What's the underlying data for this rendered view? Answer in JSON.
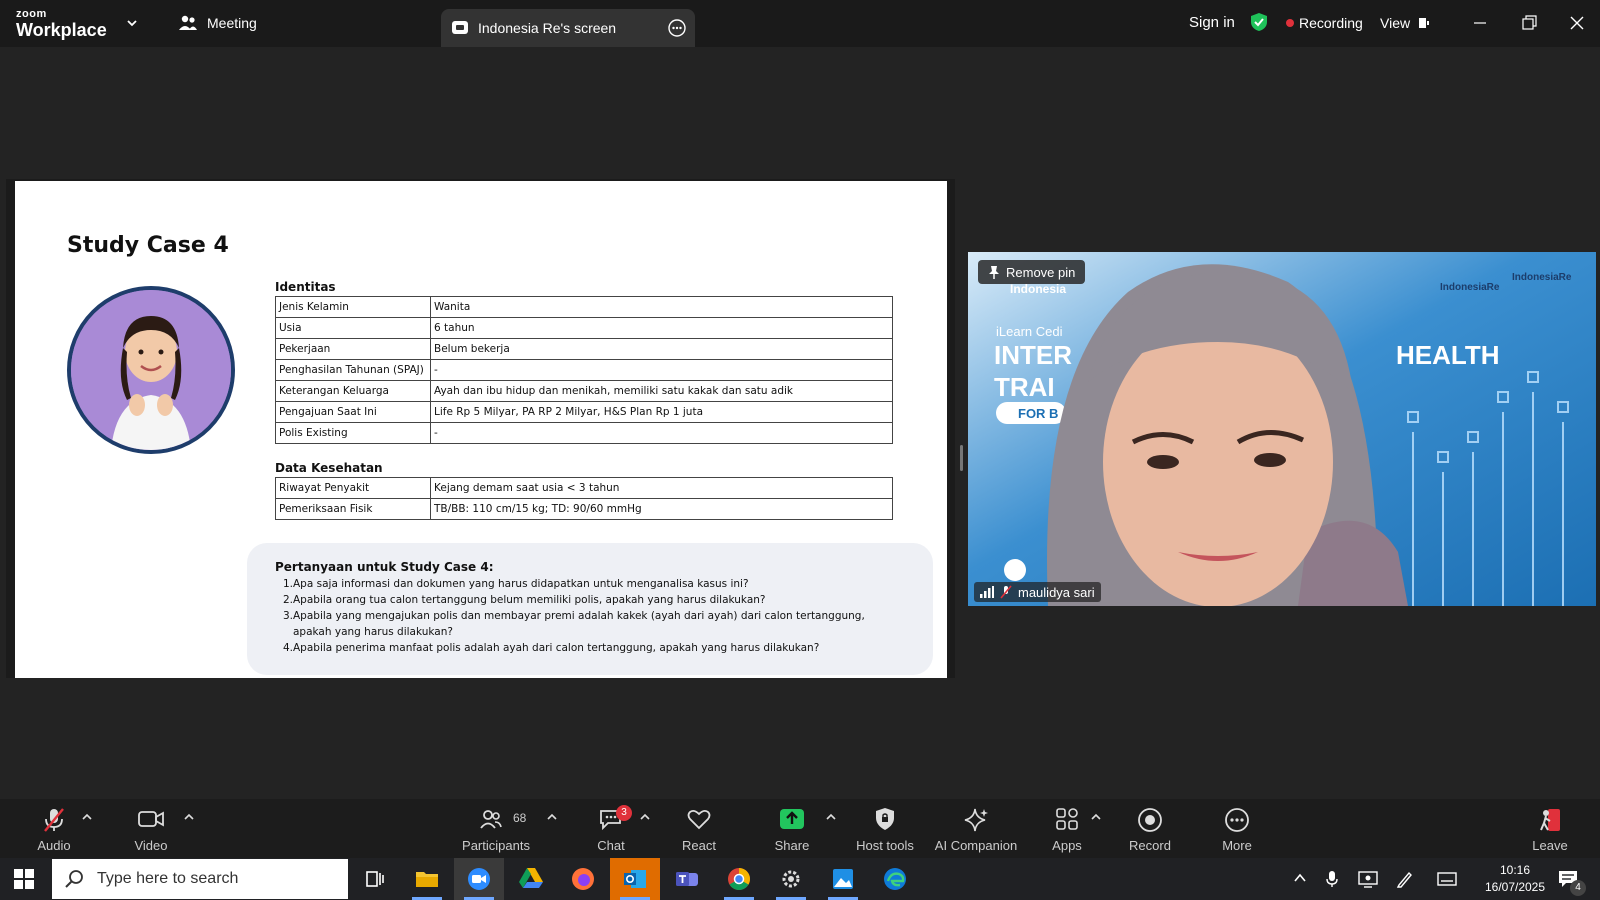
{
  "app": {
    "brand_small": "zoom",
    "brand_big": "Workplace",
    "meeting_tab": "Meeting",
    "screen_tab": "Indonesia Re's screen",
    "sign_in": "Sign in",
    "recording": "Recording",
    "view": "View"
  },
  "slide": {
    "title": "Study Case 4",
    "identitas_title": "Identitas",
    "identitas_rows": [
      {
        "k": "Jenis Kelamin",
        "v": "Wanita"
      },
      {
        "k": "Usia",
        "v": "6 tahun"
      },
      {
        "k": "Pekerjaan",
        "v": "Belum bekerja"
      },
      {
        "k": "Penghasilan Tahunan (SPAJ)",
        "v": "-"
      },
      {
        "k": "Keterangan Keluarga",
        "v": "Ayah dan ibu hidup dan menikah, memiliki satu kakak dan satu adik"
      },
      {
        "k": "Pengajuan Saat Ini",
        "v": "Life Rp 5 Milyar, PA RP 2 Milyar, H&S Plan Rp 1 juta"
      },
      {
        "k": "Polis Existing",
        "v": "-"
      }
    ],
    "kesehatan_title": "Data Kesehatan",
    "kesehatan_rows": [
      {
        "k": "Riwayat Penyakit",
        "v": "Kejang demam saat usia < 3 tahun"
      },
      {
        "k": "Pemeriksaan Fisik",
        "v": "TB/BB: 110 cm/15 kg; TD: 90/60 mmHg"
      }
    ],
    "questions_title": "Pertanyaan untuk Study Case 4:",
    "questions": [
      {
        "n": "1.",
        "t": "Apa saja informasi dan dokumen yang harus didapatkan untuk menganalisa kasus ini?"
      },
      {
        "n": "2.",
        "t": "Apabila orang tua calon tertanggung belum memiliki polis, apakah yang harus dilakukan?"
      },
      {
        "n": "3.",
        "t": "Apabila yang mengajukan polis dan membayar premi adalah kakek (ayah dari ayah) dari calon tertanggung, apakah yang harus dilakukan?"
      },
      {
        "n": "4.",
        "t": "Apabila penerima manfaat polis adalah ayah dari calon tertanggung, apakah yang harus dilakukan?"
      }
    ]
  },
  "video": {
    "remove_pin": "Remove pin",
    "participant": "maulidya sari",
    "bg_brand_left": "Indonesia",
    "bg_text_ilearn": "iLearn Cedi",
    "bg_text_inter": "INTER",
    "bg_text_train": "TRAI",
    "bg_text_health": "HEALTH",
    "bg_text_for": "FOR B",
    "bg_logo_1": "IndonesiaRe",
    "bg_logo_2": "IndonesiaRe"
  },
  "toolbar": {
    "audio": "Audio",
    "video": "Video",
    "participants": "Participants",
    "participants_count": "68",
    "chat": "Chat",
    "chat_badge": "3",
    "react": "React",
    "share": "Share",
    "host_tools": "Host tools",
    "ai_companion": "AI Companion",
    "apps": "Apps",
    "record": "Record",
    "more": "More",
    "leave": "Leave"
  },
  "taskbar": {
    "search_placeholder": "Type here to search",
    "time": "10:16",
    "date": "16/07/2025",
    "notification_count": "4"
  },
  "colors": {
    "accent_green": "#1fc25a",
    "recording_red": "#e0313b",
    "share_green": "#22c55e"
  }
}
